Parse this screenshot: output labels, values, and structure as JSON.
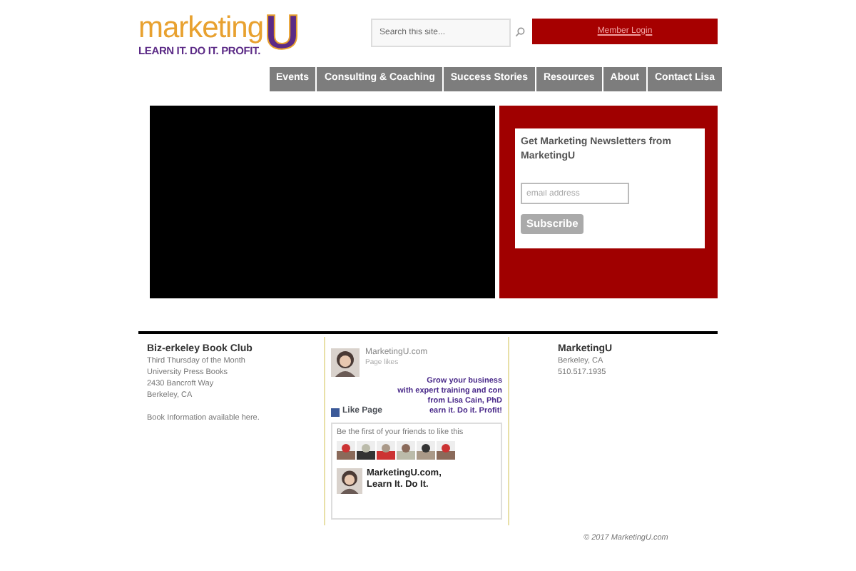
{
  "logo": {
    "word": "marketing",
    "letter": "U",
    "tagline": "LEARN IT. DO IT. PROFIT."
  },
  "search": {
    "placeholder": "Search this site..."
  },
  "member_login": "Member Login",
  "nav": [
    {
      "label": "Events"
    },
    {
      "label": "Consulting & Coaching"
    },
    {
      "label": "Success Stories"
    },
    {
      "label": "Resources"
    },
    {
      "label": "About"
    },
    {
      "label": "Contact Lisa"
    }
  ],
  "newsletter": {
    "title": "Get Marketing Newsletters from MarketingU",
    "email_placeholder": "email address",
    "button": "Subscribe"
  },
  "book_club": {
    "title": "Biz-erkeley Book Club",
    "lines": [
      "Third Thursday of the Month",
      "University Press Books",
      "2430 Bancroft Way",
      "Berkeley, CA"
    ],
    "note": "Book Information available here."
  },
  "facebook": {
    "page_name": "MarketingU.com",
    "likes": "Page likes",
    "banner": [
      "Grow your business",
      "with expert training and con",
      "from Lisa Cain, PhD",
      "earn it. Do it. Profit!"
    ],
    "like_button": "Like Page",
    "friends_text": "Be the first of your friends to like this",
    "post_name": "MarketingU.com,",
    "post_line": "Learn It. Do It."
  },
  "contact": {
    "title": "MarketingU",
    "lines": [
      "Berkeley, CA",
      "510.517.1935"
    ]
  },
  "copyright": "© 2017 MarketingU.com"
}
